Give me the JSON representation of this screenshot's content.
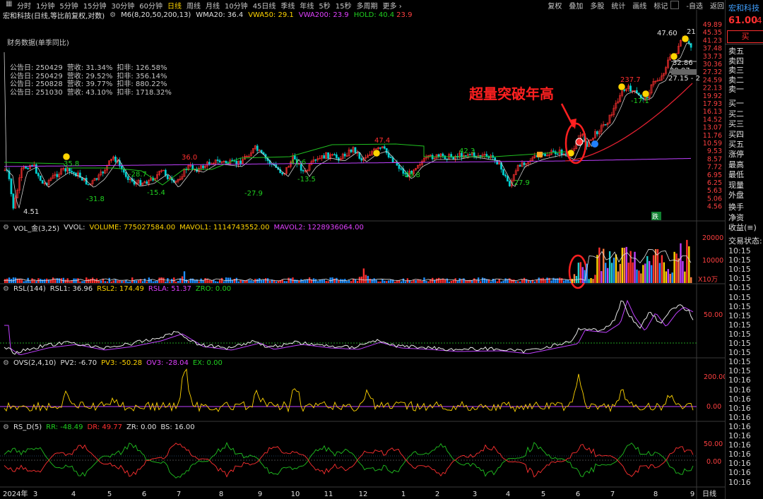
{
  "topbar": {
    "timeframes": [
      "分时",
      "1分钟",
      "5分钟",
      "15分钟",
      "30分钟",
      "60分钟",
      "日线",
      "周线",
      "月线",
      "10分钟",
      "45日线",
      "季线",
      "年线",
      "5秒",
      "15秒",
      "多周期",
      "更多 ›"
    ],
    "active_timeframe": "日线",
    "tools": [
      "复权",
      "叠加",
      "多股",
      "统计",
      "画线",
      "标记",
      "-自选",
      "返回"
    ]
  },
  "info": {
    "stock": "宏和科技(日线,等比前复权,对数)",
    "m6": "M6(8,20,50,200,13)",
    "wma20": "WMA20: 36.4",
    "vwa50": "VWA50: 29.1",
    "vwa200": "VWA200: 23.9",
    "hold": "HOLD: 40.4",
    "hold2": "23.9"
  },
  "financials": {
    "title": "财务数据(单季同比)",
    "rows": [
      {
        "date": "公告日: 250429",
        "rev": "营收: 31.34%",
        "net": "扣非: 126.58%"
      },
      {
        "date": "公告日: 250429",
        "rev": "营收: 29.52%",
        "net": "扣非: 356.14%"
      },
      {
        "date": "公告日: 250828",
        "rev": "营收: 39.77%",
        "net": "扣非: 880.22%"
      },
      {
        "date": "公告日: 251030",
        "rev": "营收: 43.10%",
        "net": "扣非: 1718.32%"
      }
    ]
  },
  "annotation": {
    "text": "超量突破年高"
  },
  "price_labels": {
    "low": "4.51",
    "p1": "-31.8",
    "p2": "35.8",
    "p3": "-15.4",
    "p4": "-28.7",
    "p5": "36.0",
    "p6": "-27.9",
    "p7": "41.6",
    "p8": "-13.5",
    "p9": "47.4",
    "p10": "-29.8",
    "p11": "42.3",
    "p12": "-27.9",
    "p13": "237.7",
    "p14": "-17.1",
    "p15": "47.60",
    "p16": "32.86",
    "p17": "29.87",
    "p18": "27.15 - 2",
    "p19": "21",
    "down_badge": "跌"
  },
  "price_axis": [
    "49.89",
    "45.35",
    "41.23",
    "37.48",
    "33.73",
    "30.36",
    "27.32",
    "24.59",
    "22.13",
    "19.92",
    "17.93",
    "16.13",
    "14.52",
    "13.07",
    "11.76",
    "10.59",
    "9.53",
    "8.57",
    "7.72",
    "6.95",
    "6.25",
    "5.63",
    "5.06",
    "4.56"
  ],
  "vol": {
    "name": "VOL_金(3,25)",
    "vvol": "VVOL:",
    "volume": "VOLUME: 775027584.00",
    "mavol1": "MAVOL1: 1114743552.00",
    "mavol2": "MAVOL2: 1228936064.00",
    "axis": [
      "20000",
      "10000"
    ],
    "unit": "X10万"
  },
  "rsl": {
    "name": "RSL(144)",
    "rsl1": "RSL1: 36.96",
    "rsl2": "RSL2: 174.49",
    "rsla": "RSLA: 51.37",
    "zro": "ZRO: 0.00",
    "axis": "50.00"
  },
  "ovs": {
    "name": "OVS(2,4,10)",
    "pv2": "PV2: -6.70",
    "pv3": "PV3: -50.28",
    "ov3": "OV3: -28.04",
    "ex": "EX: 0.00",
    "axis": [
      "200.00",
      "0.00"
    ]
  },
  "rsd": {
    "name": "RS_D(5)",
    "rr": "RR: -48.49",
    "dr": "DR: 49.77",
    "zr": "ZR: 0.00",
    "bs": "BS: 16.00",
    "axis": [
      "50.00",
      "0.00"
    ]
  },
  "xaxis": {
    "year": "2024年",
    "months": [
      "3",
      "4",
      "5",
      "6",
      "7",
      "8",
      "9",
      "10",
      "11",
      "12",
      "1",
      "2",
      "3",
      "4",
      "5",
      "6",
      "7",
      "8",
      "9"
    ],
    "period": "日线"
  },
  "right_panel": {
    "name": "宏和科技",
    "price": "61.00",
    "change": "4.",
    "buy_button": "买",
    "asks": [
      "卖五",
      "卖四",
      "卖三",
      "卖二",
      "卖一"
    ],
    "bids": [
      "买一",
      "买二",
      "买三",
      "买四",
      "买五"
    ],
    "stats": [
      "涨停",
      "最高",
      "最低",
      "现量",
      "外盘"
    ],
    "stats2": [
      "换手",
      "净资",
      "收益(≡)"
    ],
    "trade_status": "交易状态: ",
    "times": [
      "10:15",
      "10:15",
      "10:15",
      "10:15",
      "10:15",
      "10:15",
      "10:15",
      "10:15",
      "10:15",
      "10:15",
      "10:15",
      "10:15",
      "10:15",
      "10:15",
      "10:16",
      "10:16",
      "10:16",
      "10:16",
      "10:16",
      "10:16",
      "10:16",
      "10:16",
      "10:16",
      "10:16",
      "10:16",
      "10:16"
    ]
  },
  "colors": {
    "bg": "#000000",
    "up": "#ff3030",
    "down": "#00d0d0",
    "wma": "#d0d0d0",
    "vwa50": "#20c020",
    "vwa200": "#c040ff",
    "red_line": "#e02030",
    "yellow": "#ffd400",
    "annotation": "#ff2020"
  }
}
